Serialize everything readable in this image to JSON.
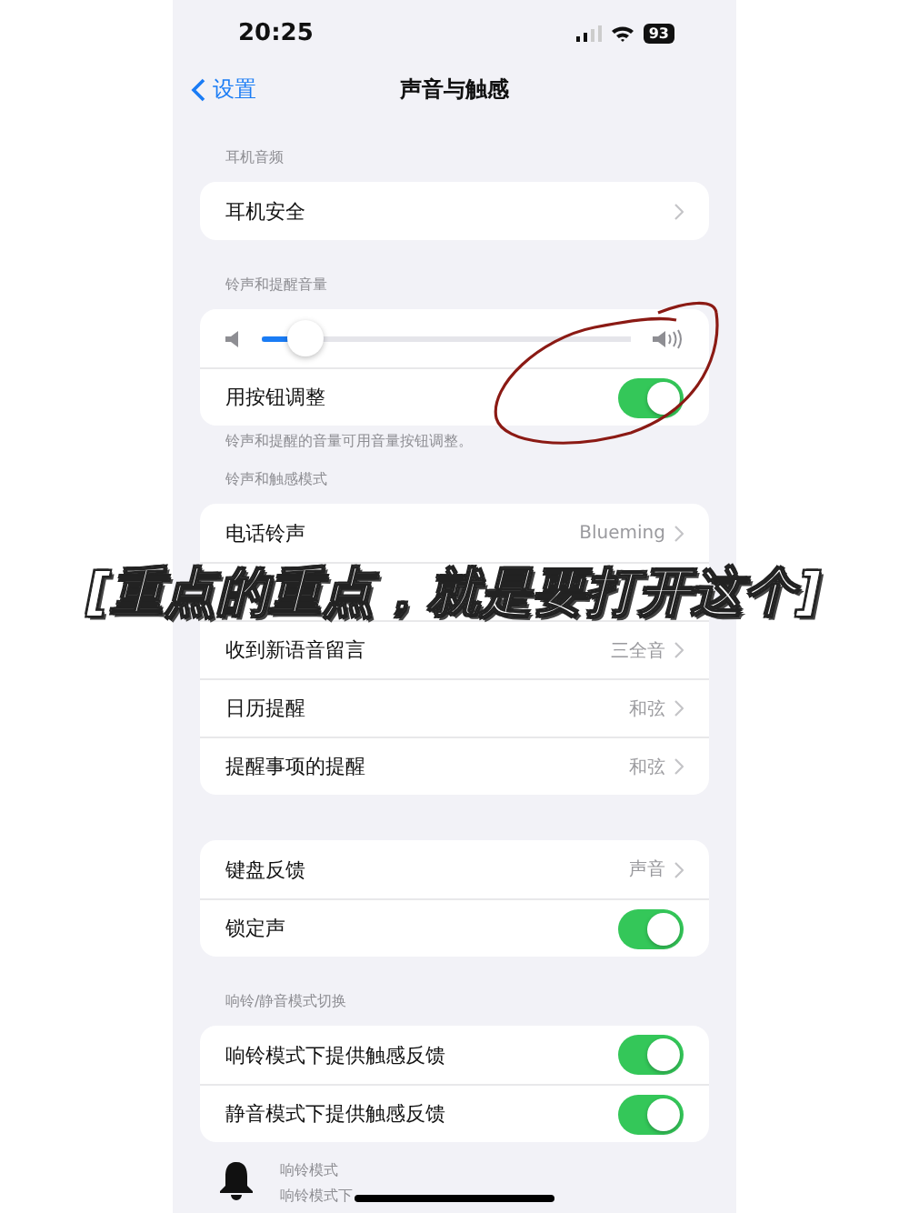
{
  "status_bar": {
    "time": "20:25",
    "battery": "93"
  },
  "nav": {
    "back": "设置",
    "title": "声音与触感"
  },
  "sections": [
    {
      "header": "耳机音频",
      "rows": [
        {
          "kind": "link",
          "label": "耳机安全"
        }
      ]
    },
    {
      "header": "铃声和提醒音量",
      "footer": "铃声和提醒的音量可用音量按钮调整。",
      "rows": [
        {
          "kind": "slider",
          "level": 0.12
        },
        {
          "kind": "toggle",
          "label": "用按钮调整",
          "on": true
        }
      ]
    },
    {
      "header": "铃声和触感模式",
      "rows": [
        {
          "kind": "link",
          "label": "电话铃声",
          "value": "Blueming"
        },
        {
          "kind": "annotation",
          "text": "[重点的重点，就是要打开这个]"
        },
        {
          "kind": "link",
          "label": "收到新语音留言",
          "value": "三全音"
        },
        {
          "kind": "link",
          "label": "日历提醒",
          "value": "和弦"
        },
        {
          "kind": "link",
          "label": "提醒事项的提醒",
          "value": "和弦"
        }
      ]
    },
    {
      "rows": [
        {
          "kind": "link",
          "label": "键盘反馈",
          "value": "声音"
        },
        {
          "kind": "toggle",
          "label": "锁定声",
          "on": true
        }
      ]
    },
    {
      "header": "响铃/静音模式切换",
      "rows": [
        {
          "kind": "toggle",
          "label": "响铃模式下提供触感反馈",
          "on": true
        },
        {
          "kind": "toggle",
          "label": "静音模式下提供触感反馈",
          "on": true
        }
      ]
    }
  ],
  "ring_mode": {
    "title": "响铃模式",
    "description": "响铃模式下"
  }
}
